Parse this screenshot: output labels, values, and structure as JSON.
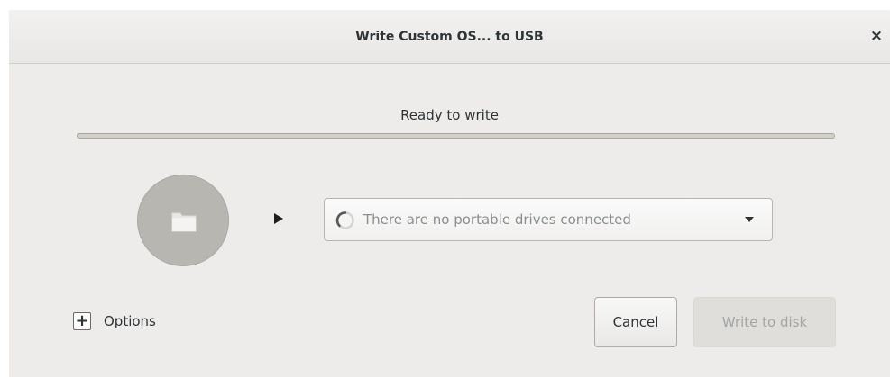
{
  "window": {
    "title": "Write Custom OS... to USB",
    "close_symbol": "×"
  },
  "progress": {
    "status_text": "Ready to write",
    "fraction": 0
  },
  "source": {
    "icon": "folder-icon"
  },
  "destination": {
    "placeholder": "There are no portable drives connected",
    "icon": "spinner-icon"
  },
  "options": {
    "expand_symbol": "+",
    "label": "Options"
  },
  "actions": {
    "cancel_label": "Cancel",
    "write_label": "Write to disk"
  },
  "colors": {
    "window_bg": "#edeceb",
    "folder_circle": "#b8b6b1",
    "disabled_text": "#a3a5a5"
  }
}
